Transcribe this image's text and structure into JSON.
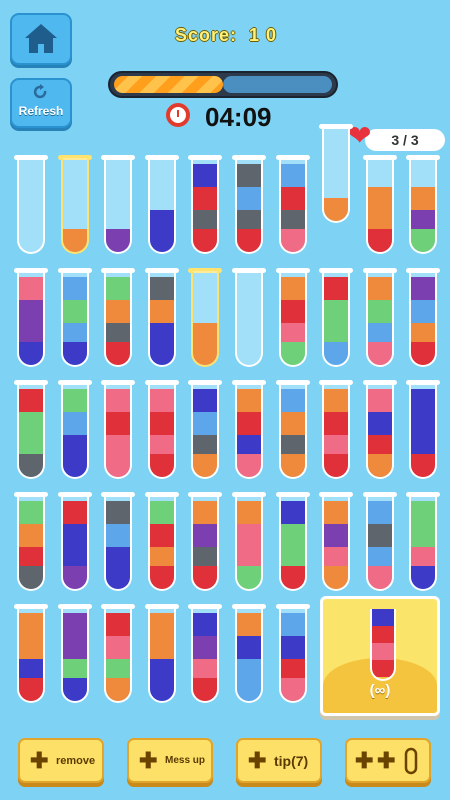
{
  "header": {
    "score_label": "Score:",
    "score_value": "1 0",
    "refresh_label": "Refresh",
    "timer": "04:09",
    "lives": "3 / 3",
    "progress": 0.5
  },
  "colors": {
    "r": "#e0303a",
    "b": "#3d3ac8",
    "o": "#ef8a3c",
    "g": "#6fd07a",
    "p": "#7b3fb0",
    "d": "#5f656d",
    "k": "#ef6b86",
    "l": "#5ea6ea"
  },
  "tubes_rows": [
    [
      [],
      [
        "o"
      ],
      [
        "p"
      ],
      [
        "b",
        "b"
      ],
      [
        "b",
        "r",
        "d",
        "r"
      ],
      [
        "d",
        "l",
        "d",
        "r"
      ],
      [
        "l",
        "r",
        "d",
        "k"
      ],
      [
        "o"
      ],
      [
        "o",
        "o",
        "r"
      ],
      [
        "o",
        "p",
        "g"
      ]
    ],
    [
      [
        "k",
        "p",
        "p",
        "b"
      ],
      [
        "l",
        "g",
        "l",
        "b"
      ],
      [
        "g",
        "o",
        "d",
        "r"
      ],
      [
        "d",
        "o",
        "b",
        "b"
      ],
      [
        "o",
        "o"
      ],
      [],
      [
        "o",
        "r",
        "k",
        "g"
      ],
      [
        "r",
        "g",
        "g",
        "l"
      ],
      [
        "o",
        "g",
        "l",
        "k"
      ],
      [
        "p",
        "l",
        "o",
        "r"
      ]
    ],
    [
      [
        "r",
        "g",
        "g",
        "d"
      ],
      [
        "g",
        "l",
        "b",
        "b"
      ],
      [
        "k",
        "r",
        "k",
        "k"
      ],
      [
        "k",
        "r",
        "k",
        "r"
      ],
      [
        "b",
        "l",
        "d",
        "o"
      ],
      [
        "o",
        "r",
        "b",
        "k"
      ],
      [
        "l",
        "o",
        "d",
        "o"
      ],
      [
        "o",
        "r",
        "k",
        "r"
      ],
      [
        "k",
        "b",
        "r",
        "o"
      ],
      [
        "b",
        "b",
        "b",
        "r"
      ]
    ],
    [
      [
        "g",
        "o",
        "r",
        "d"
      ],
      [
        "r",
        "b",
        "b",
        "p"
      ],
      [
        "d",
        "l",
        "b",
        "b"
      ],
      [
        "g",
        "r",
        "o",
        "r"
      ],
      [
        "o",
        "p",
        "d",
        "r"
      ],
      [
        "o",
        "k",
        "k",
        "g"
      ],
      [
        "b",
        "g",
        "g",
        "r"
      ],
      [
        "o",
        "p",
        "k",
        "o"
      ],
      [
        "l",
        "d",
        "l",
        "k"
      ],
      [
        "g",
        "g",
        "k",
        "b"
      ]
    ],
    [
      [
        "o",
        "o",
        "b",
        "r"
      ],
      [
        "p",
        "p",
        "g",
        "b"
      ],
      [
        "r",
        "k",
        "g",
        "o"
      ],
      [
        "o",
        "o",
        "b",
        "b"
      ],
      [
        "b",
        "p",
        "k",
        "r"
      ],
      [
        "o",
        "b",
        "l",
        "l"
      ],
      [
        "l",
        "b",
        "r",
        "k"
      ]
    ]
  ],
  "bonus": {
    "tube": [
      "b",
      "r",
      "k",
      "r"
    ],
    "label": "(∞)"
  },
  "buttons": {
    "remove": "remove",
    "mess_up": "Mess up",
    "tip": "tip(7)"
  },
  "selected": [
    [
      0,
      1
    ],
    [
      1,
      4
    ]
  ]
}
